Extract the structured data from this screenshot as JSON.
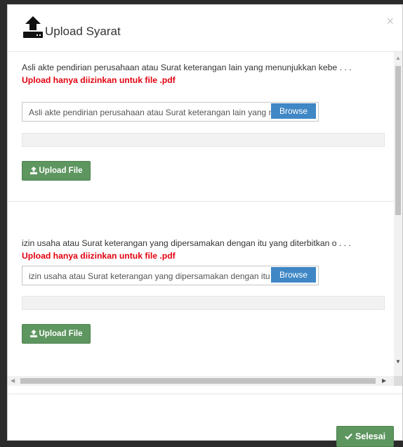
{
  "modal": {
    "title": "Upload Syarat",
    "close_label": "×",
    "header_icon": "upload-icon"
  },
  "requirements": [
    {
      "title": "Asli akte pendirian perusahaan atau Surat keterangan lain yang menunjukkan kebe . . .",
      "note": "Upload hanya diizinkan untuk file .pdf",
      "file_placeholder": "Asli  akte pendirian perusahaan atau Surat keterangan lain yang menunjukkan",
      "browse_label": "Browse",
      "upload_label": "Upload File",
      "progress": 0
    },
    {
      "title": "izin usaha atau Surat keterangan yang dipersamakan dengan itu yang diterbitkan o . . .",
      "note": "Upload hanya diizinkan untuk file .pdf",
      "file_placeholder": "izin usaha atau Surat keterangan yang dipersamakan dengan itu yang diterbitkan",
      "browse_label": "Browse",
      "upload_label": "Upload File",
      "progress": 0
    }
  ],
  "footer": {
    "done_label": "Selesai",
    "done_icon": "check-icon"
  },
  "colors": {
    "note_red": "#e3000f",
    "browse_blue": "#3f87c5",
    "button_green": "#5e9660"
  }
}
